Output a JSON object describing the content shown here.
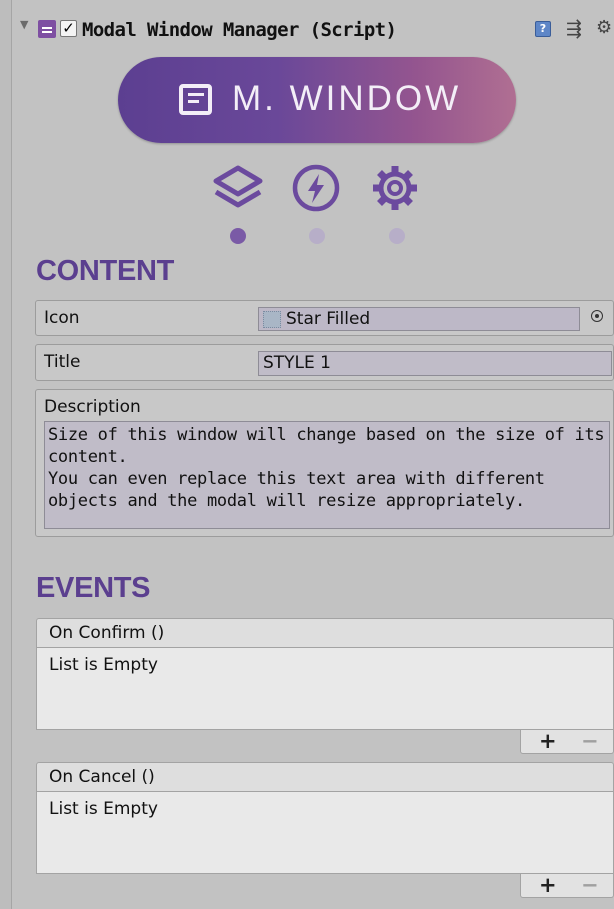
{
  "component": {
    "title": "Modal Window Manager (Script)",
    "checkbox_mark": "✓",
    "fold_glyph": "▼",
    "help_glyph": "?",
    "presets_glyph": "⇶",
    "settings_glyph": "⚙"
  },
  "banner": {
    "text": "M. WINDOW",
    "icon": "modal-window-icon",
    "colors": {
      "gradient_start": "#5c3f91",
      "gradient_end": "#b06f92"
    }
  },
  "tabs": [
    {
      "icon": "layers-icon",
      "active": true
    },
    {
      "icon": "lightning-icon",
      "active": false
    },
    {
      "icon": "gear-icon",
      "active": false
    }
  ],
  "content": {
    "heading": "CONTENT",
    "icon_field": {
      "label": "Icon",
      "value": "Star Filled"
    },
    "title_field": {
      "label": "Title",
      "value": "STYLE 1"
    },
    "description_field": {
      "label": "Description",
      "lines": [
        "Size of this window will change based on the size of its",
        "content.",
        "You can even replace this text area with different",
        "objects and the modal will resize appropriately."
      ]
    }
  },
  "events": {
    "heading": "EVENTS",
    "lists": [
      {
        "header": "On Confirm ()",
        "empty_text": "List is Empty",
        "add": "+",
        "remove": "−"
      },
      {
        "header": "On Cancel ()",
        "empty_text": "List is Empty",
        "add": "+",
        "remove": "−"
      }
    ]
  },
  "colors": {
    "accent": "#5b3f8f",
    "panel_bg": "#c2c2c2"
  }
}
